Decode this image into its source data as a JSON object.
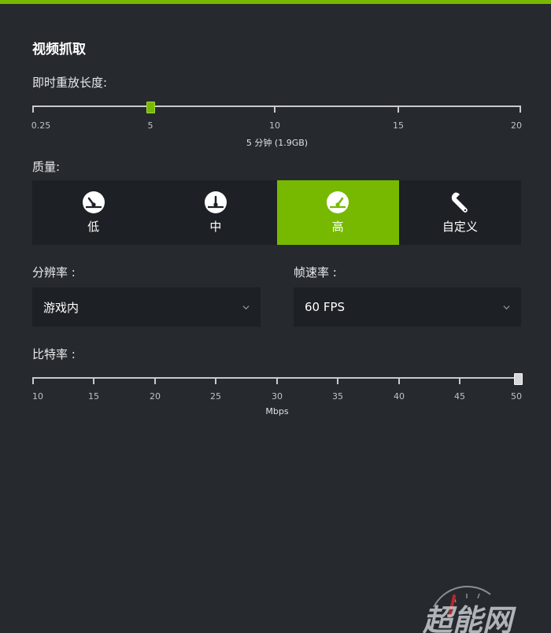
{
  "section_title": "视频抓取",
  "replay": {
    "label": "即时重放长度:",
    "ticks": [
      "0.25",
      "5",
      "10",
      "15",
      "20"
    ],
    "min": 0.25,
    "max": 20,
    "value": 5,
    "caption": "5 分钟 (1.9GB)"
  },
  "quality": {
    "label": "质量:",
    "options": [
      {
        "label": "低",
        "icon": "speedometer-low-icon"
      },
      {
        "label": "中",
        "icon": "speedometer-medium-icon"
      },
      {
        "label": "高",
        "icon": "speedometer-high-icon"
      },
      {
        "label": "自定义",
        "icon": "wrench-icon"
      }
    ],
    "selected": "高"
  },
  "resolution": {
    "label": "分辨率 :",
    "value": "游戏内"
  },
  "framerate": {
    "label": "帧速率 :",
    "value": "60 FPS"
  },
  "bitrate": {
    "label": "比特率 :",
    "ticks": [
      "10",
      "15",
      "20",
      "25",
      "30",
      "35",
      "40",
      "45",
      "50"
    ],
    "min": 10,
    "max": 50,
    "value": 50,
    "caption": "Mbps"
  },
  "watermark": "超能网",
  "colors": {
    "accent": "#76b900",
    "background": "#262a2f",
    "panel": "#1d2024"
  }
}
